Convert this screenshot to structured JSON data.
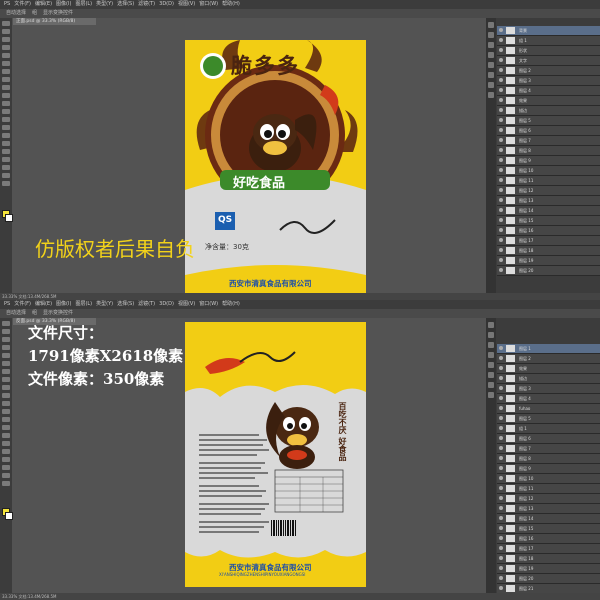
{
  "top": {
    "menu": [
      "PS",
      "文件(F)",
      "编辑(E)",
      "图像(I)",
      "图层(L)",
      "类型(Y)",
      "选择(S)",
      "滤镜(T)",
      "3D(D)",
      "视图(V)",
      "窗口(W)",
      "帮助(H)"
    ],
    "options": [
      "自动选择",
      "组",
      "显示变换控件"
    ],
    "doc_tab": "正面.psd @ 33.3% (RGB/8)",
    "watermark": "仿版权者后果自负",
    "front": {
      "brand": "脆多多",
      "badge": "好吃食品",
      "qs": "QS",
      "net_weight": "净含量：30克",
      "company": "西安市清真食品有限公司"
    },
    "layers": [
      "背景",
      "组 1",
      "形状",
      "文字",
      "图层 2",
      "图层 3",
      "图层 4",
      "效果",
      "描边",
      "图层 5",
      "图层 6",
      "图层 7",
      "图层 8",
      "图层 9",
      "图层 10",
      "图层 11",
      "图层 12",
      "图层 13",
      "图层 14",
      "图层 15",
      "图层 16",
      "图层 17",
      "图层 18",
      "图层 19",
      "图层 20"
    ],
    "status": "33.33%  文档:13.4M/268.5M"
  },
  "bottom": {
    "menu": [
      "PS",
      "文件(F)",
      "编辑(E)",
      "图像(I)",
      "图层(L)",
      "类型(Y)",
      "选择(S)",
      "滤镜(T)",
      "3D(D)",
      "视图(V)",
      "窗口(W)",
      "帮助(H)"
    ],
    "options": [
      "自动选择",
      "组",
      "显示变换控件"
    ],
    "doc_tab": "反面.psd @ 33.3% (RGB/8)",
    "spec": {
      "line1": "文件尺寸：",
      "line2": "1791像素X2618像素",
      "line3": "文件像素：350像素"
    },
    "back": {
      "slogan": "百吃不厌 好食品",
      "company": "西安市清真食品有限公司",
      "company_en": "XI'ANSHIQINGZHENSHIPINYOUXIANGONGSI"
    },
    "layers": [
      "图层 1",
      "图层 2",
      "效果",
      "描边",
      "图层 3",
      "图层 4",
      "fuhao",
      "图层 5",
      "组 1",
      "图层 6",
      "图层 7",
      "图层 8",
      "图层 9",
      "图层 10",
      "图层 11",
      "图层 12",
      "图层 13",
      "图层 14",
      "图层 15",
      "图层 16",
      "图层 17",
      "图层 18",
      "图层 19",
      "图层 20",
      "图层 21",
      "背景"
    ],
    "status": "33.33%  文档:13.4M/268.5M"
  }
}
